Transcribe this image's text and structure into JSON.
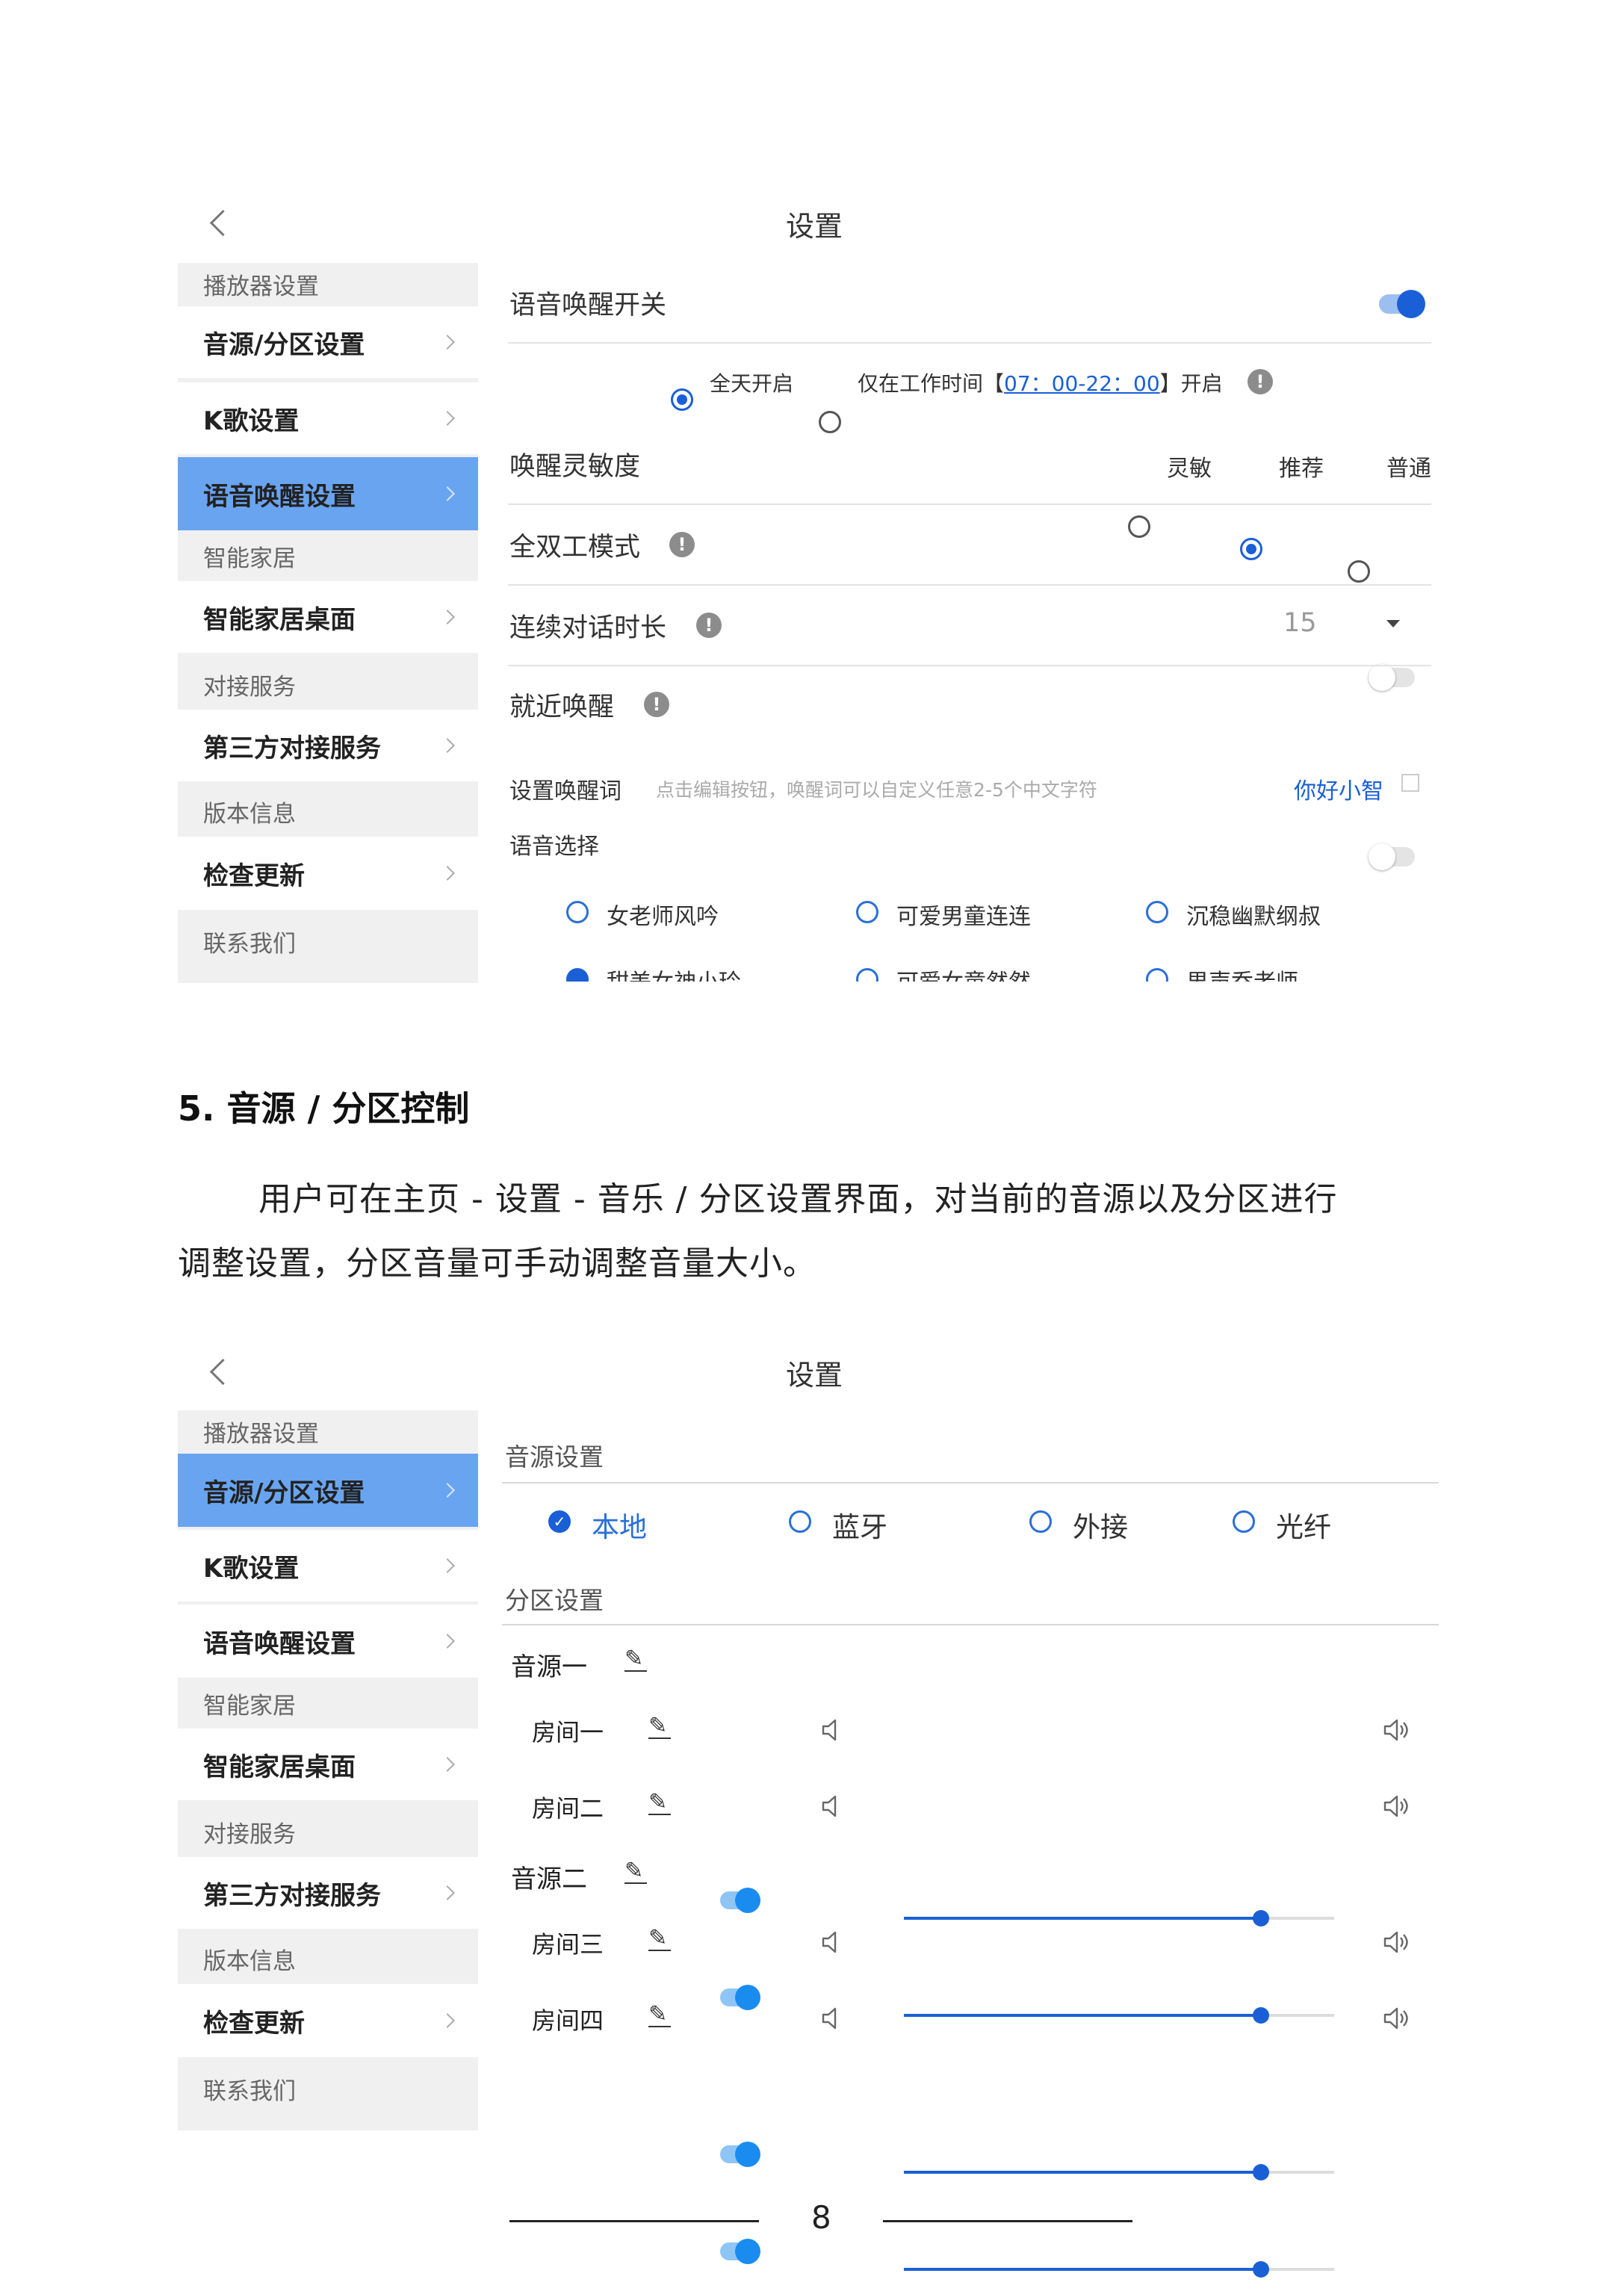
{
  "screen1": {
    "title": "设置",
    "sidebar": {
      "groups": [
        {
          "header": "播放器设置",
          "items": [
            "音源/分区设置",
            "K歌设置",
            "语音唤醒设置"
          ]
        },
        {
          "header": "智能家居",
          "items": [
            "智能家居桌面"
          ]
        },
        {
          "header": "对接服务",
          "items": [
            "第三方对接服务"
          ]
        },
        {
          "header": "版本信息",
          "items": [
            "检查更新"
          ]
        },
        {
          "header": "联系我们",
          "items": []
        }
      ],
      "active": "语音唤醒设置"
    },
    "wake_switch": {
      "label": "语音唤醒开关",
      "on": true
    },
    "schedule": {
      "all_day": "全天开启",
      "work_time_prefix": "仅在工作时间【",
      "work_time": "07：00-22：00",
      "work_time_suffix": "】开启",
      "selected": "全天开启"
    },
    "sensitivity": {
      "label": "唤醒灵敏度",
      "options": [
        "灵敏",
        "推荐",
        "普通"
      ],
      "selected": "推荐"
    },
    "full_duplex": {
      "label": "全双工模式",
      "on": false
    },
    "dialog_duration": {
      "label": "连续对话时长",
      "value": "15"
    },
    "nearby_wake": {
      "label": "就近唤醒",
      "on": false
    },
    "wake_word": {
      "label": "设置唤醒词",
      "hint": "点击编辑按钮，唤醒词可以自定义任意2-5个中文字符",
      "value": "你好小智"
    },
    "voice": {
      "label": "语音选择",
      "options": [
        "女老师风吟",
        "可爱男童连连",
        "沉稳幽默纲叔",
        "甜美女神小玲",
        "可爱女童然然",
        "男声乔老师"
      ],
      "selected": "甜美女神小玲"
    }
  },
  "doc": {
    "heading": "5. 音源 / 分区控制",
    "para_line1": "用户可在主页 - 设置 - 音乐 / 分区设置界面，对当前的音源以及分区进行",
    "para_line2": "调整设置，分区音量可手动调整音量大小。"
  },
  "screen2": {
    "title": "设置",
    "sidebar": {
      "groups": [
        {
          "header": "播放器设置",
          "items": [
            "音源/分区设置",
            "K歌设置",
            "语音唤醒设置"
          ]
        },
        {
          "header": "智能家居",
          "items": [
            "智能家居桌面"
          ]
        },
        {
          "header": "对接服务",
          "items": [
            "第三方对接服务"
          ]
        },
        {
          "header": "版本信息",
          "items": [
            "检查更新"
          ]
        },
        {
          "header": "联系我们",
          "items": []
        }
      ],
      "active": "音源/分区设置"
    },
    "source_section": "音源设置",
    "sources": [
      "本地",
      "蓝牙",
      "外接",
      "光纤"
    ],
    "source_selected": "本地",
    "zone_section": "分区设置",
    "zones": [
      {
        "name": "音源一",
        "rooms": [
          {
            "name": "房间一",
            "on": true,
            "volume": 0.83
          },
          {
            "name": "房间二",
            "on": true,
            "volume": 0.83
          }
        ]
      },
      {
        "name": "音源二",
        "rooms": [
          {
            "name": "房间三",
            "on": true,
            "volume": 0.83
          },
          {
            "name": "房间四",
            "on": true,
            "volume": 0.83
          }
        ]
      }
    ]
  },
  "page_number": "8",
  "colors": {
    "accent": "#1a5fd6",
    "sidebar_active": "#69a4f0",
    "sidebar_bg": "#f0f0f0"
  }
}
